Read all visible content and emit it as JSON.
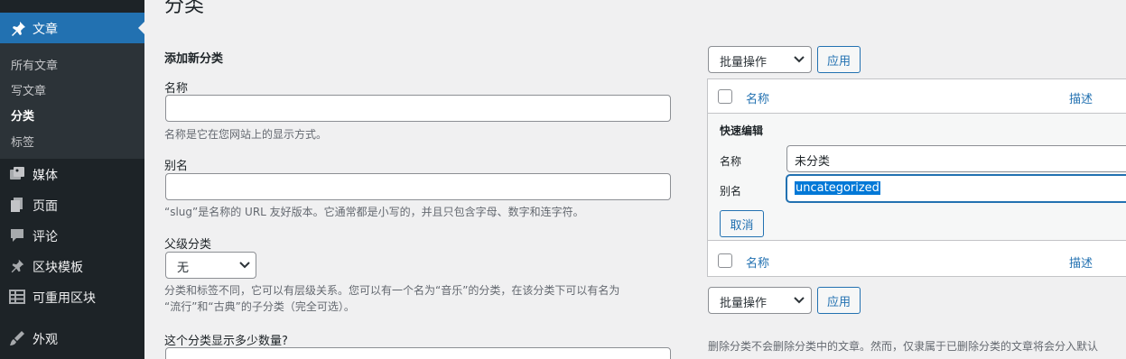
{
  "sidebar": {
    "active_menu": {
      "label": "文章",
      "icon": "pushpin-icon"
    },
    "submenu": [
      {
        "label": "所有文章",
        "current": false
      },
      {
        "label": "写文章",
        "current": false
      },
      {
        "label": "分类",
        "current": true
      },
      {
        "label": "标签",
        "current": false
      }
    ],
    "menu": [
      {
        "label": "媒体",
        "icon": "media-icon"
      },
      {
        "label": "页面",
        "icon": "page-icon"
      },
      {
        "label": "评论",
        "icon": "comment-icon"
      },
      {
        "label": "区块模板",
        "icon": "pushpin-icon"
      },
      {
        "label": "可重用区块",
        "icon": "table-icon"
      },
      {
        "label": "外观",
        "icon": "brush-icon"
      }
    ]
  },
  "page": {
    "title": "分类"
  },
  "add_form": {
    "heading": "添加新分类",
    "name": {
      "label": "名称",
      "value": "",
      "description": "名称是它在您网站上的显示方式。"
    },
    "slug": {
      "label": "别名",
      "value": "",
      "description": "“slug”是名称的 URL 友好版本。它通常都是小写的，并且只包含字母、数字和连字符。"
    },
    "parent": {
      "label": "父级分类",
      "selected": "无",
      "description_line1": "分类和标签不同，它可以有层级关系。您可以有一个名为“音乐”的分类，在该分类下可以有名为",
      "description_line2": "“流行”和“古典”的子分类（完全可选）。"
    },
    "count": {
      "label": "这个分类显示多少数量?"
    }
  },
  "list": {
    "bulk_top": {
      "selected": "批量操作",
      "apply": "应用"
    },
    "bulk_bottom": {
      "selected": "批量操作",
      "apply": "应用"
    },
    "columns": {
      "name": "名称",
      "description": "描述"
    },
    "quick_edit": {
      "title": "快速编辑",
      "name_label": "名称",
      "name_value": "未分类",
      "slug_label": "别名",
      "slug_value": "uncategorized",
      "cancel": "取消"
    },
    "footer_note": "删除分类不会删除分类中的文章。然而，仅隶属于已删除分类的文章将会分入默认"
  },
  "colors": {
    "sidebar_bg": "#1d2327",
    "submenu_bg": "#2c3338",
    "accent": "#2271b1",
    "page_bg": "#f0f0f1"
  }
}
